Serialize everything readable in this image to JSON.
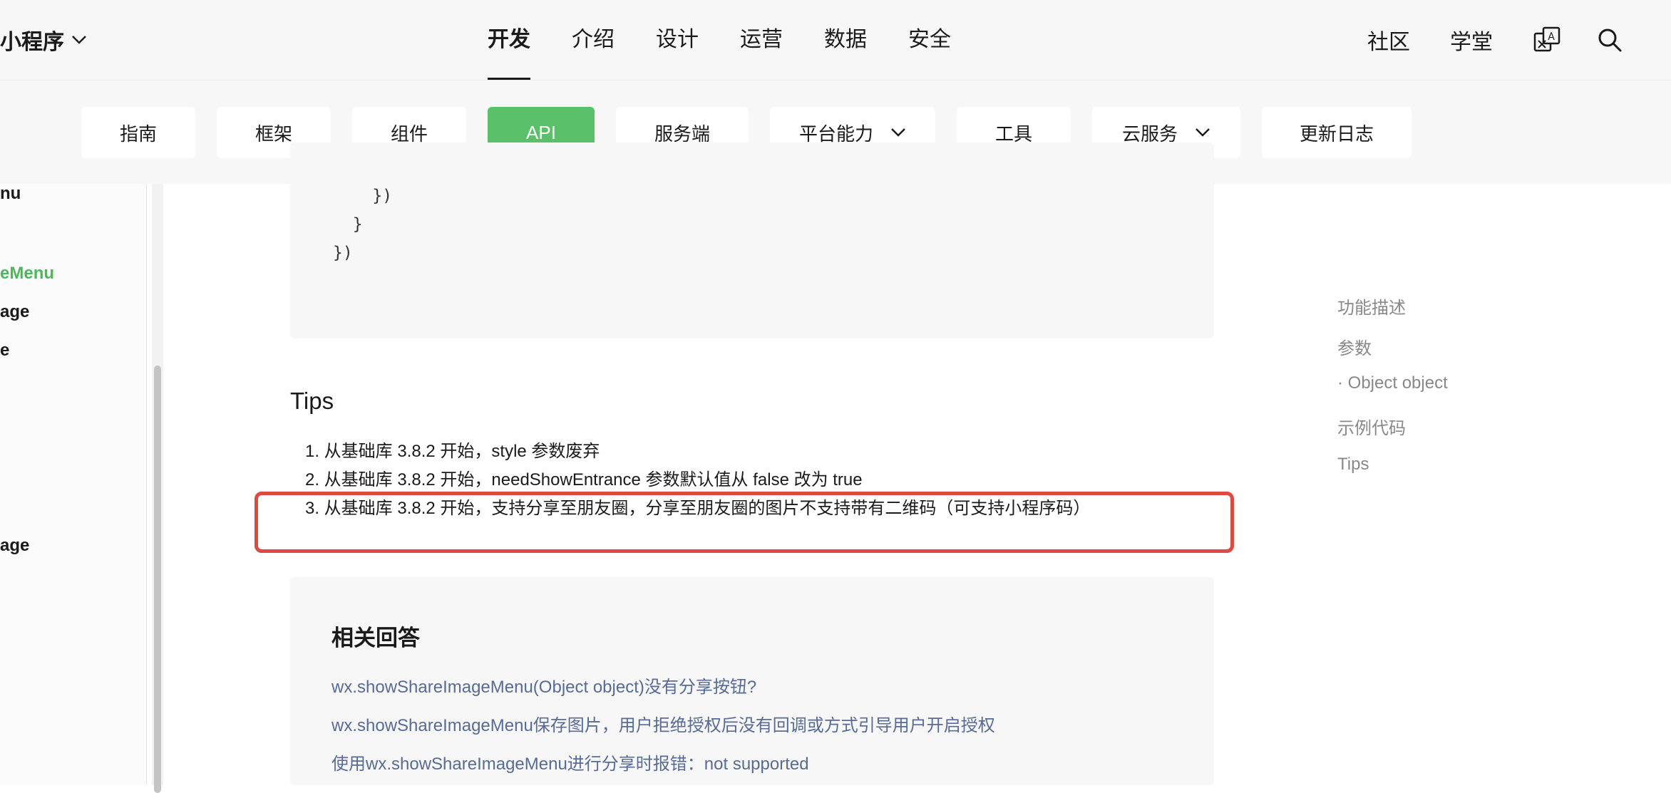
{
  "header": {
    "brand": "小程序",
    "nav": [
      "开发",
      "介绍",
      "设计",
      "运营",
      "数据",
      "安全"
    ],
    "active_nav": "开发",
    "right_links": [
      "社区",
      "学堂"
    ],
    "icons": [
      "translate-icon",
      "search-icon"
    ]
  },
  "subnav": {
    "items": [
      "指南",
      "框架",
      "组件",
      "API",
      "服务端",
      "平台能力",
      "工具",
      "云服务",
      "更新日志"
    ],
    "active": "API",
    "dropdown_items": [
      "平台能力",
      "云服务"
    ],
    "accent_color": "#5ac06a"
  },
  "sidebar": {
    "items": [
      "nu",
      "eMenu",
      "age",
      "e",
      "age"
    ],
    "active": "eMenu",
    "active_color": "#4cb75c"
  },
  "code": {
    "lines": [
      "    })",
      "  }",
      "})"
    ]
  },
  "tips": {
    "heading": "Tips",
    "items": [
      "1. 从基础库 3.8.2 开始，style 参数废弃",
      "2. 从基础库 3.8.2 开始，needShowEntrance 参数默认值从 false 改为 true",
      "3. 从基础库 3.8.2 开始，支持分享至朋友圈，分享至朋友圈的图片不支持带有二维码（可支持小程序码）"
    ],
    "highlight_color": "#dc4a40"
  },
  "answers": {
    "heading": "相关回答",
    "links": [
      "wx.showShareImageMenu(Object object)没有分享按钮?",
      "wx.showShareImageMenu保存图片，用户拒绝授权后没有回调或方式引导用户开启授权",
      "使用wx.showShareImageMenu进行分享时报错：not supported"
    ],
    "link_color": "#576b95"
  },
  "toc": {
    "items": [
      "功能描述",
      "参数",
      "· Object object",
      "示例代码",
      "Tips"
    ]
  }
}
